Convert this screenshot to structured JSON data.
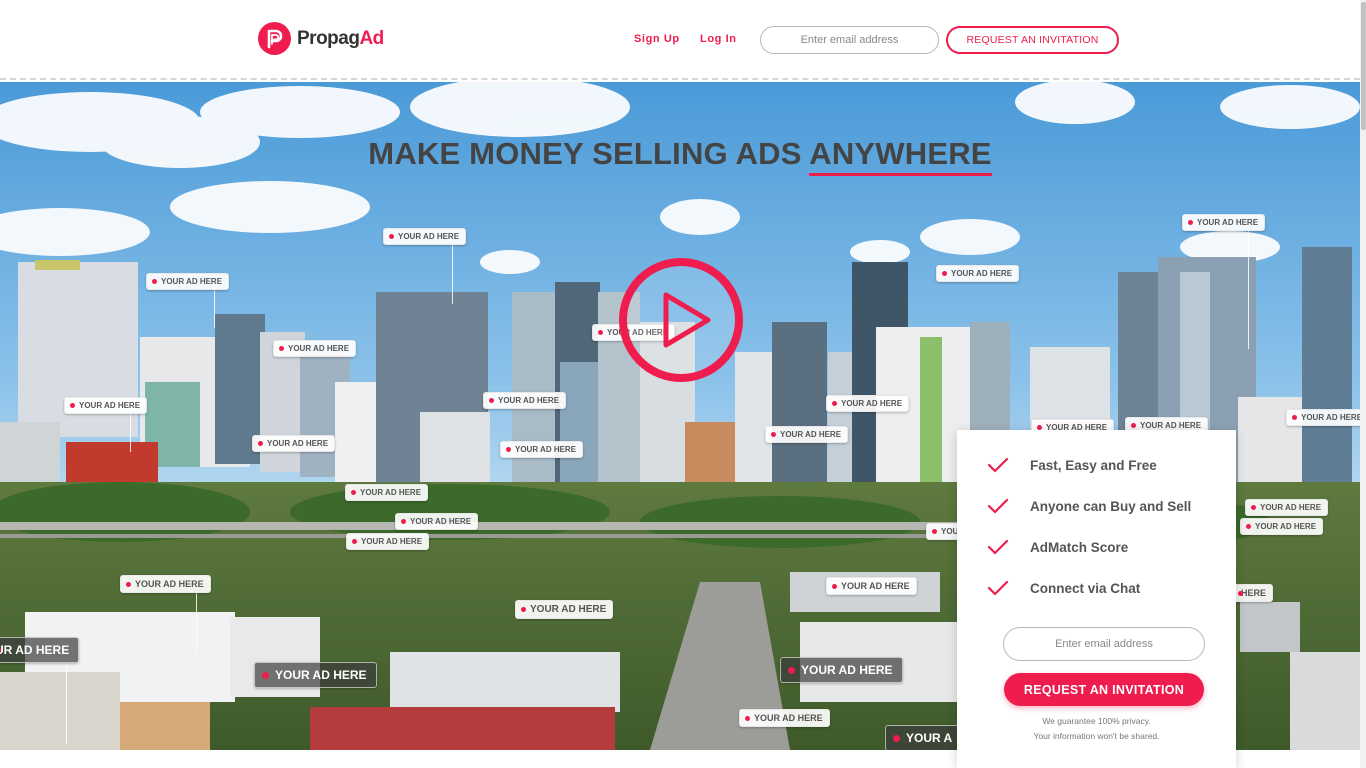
{
  "brand": {
    "name_main": "Propag",
    "name_accent": "Ad",
    "accent_color": "#ef1c4e",
    "logo_icon": "propagad-p-logo-icon"
  },
  "nav": {
    "sign_up": "Sign Up",
    "log_in": "Log In",
    "email_placeholder": "Enter email address",
    "cta": "REQUEST AN INVITATION"
  },
  "hero": {
    "headline_main": "MAKE MONEY SELLING ADS ",
    "headline_accent": "ANYWHERE",
    "play_icon": "play-icon",
    "ad_tag_label": "YOUR AD HERE",
    "ad_tag_partial_left": "UR AD HERE",
    "ad_tag_partial_right": "HERE",
    "ad_tag_partial_bottom": "YOUR A",
    "ad_tag_partial_mini": "YOUR"
  },
  "signup_card": {
    "features": [
      "Fast, Easy and Free",
      "Anyone can Buy and Sell",
      "AdMatch Score",
      "Connect via Chat"
    ],
    "check_icon": "checkmark-icon",
    "email_placeholder": "Enter email address",
    "cta": "REQUEST AN INVITATION",
    "privacy_line1": "We guarantee 100% privacy.",
    "privacy_line2": "Your information won't be shared."
  }
}
